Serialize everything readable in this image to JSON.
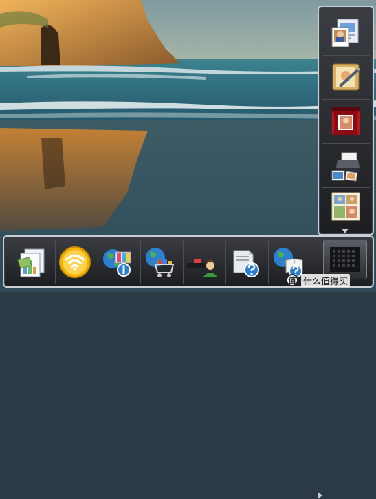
{
  "watermark": {
    "badge": "值",
    "text": "什么值得买"
  },
  "side_tray": {
    "items": [
      {
        "icon": "photo-album-icon"
      },
      {
        "icon": "photo-edit-icon"
      },
      {
        "icon": "slideshow-theater-icon"
      },
      {
        "icon": "photo-printer-icon"
      },
      {
        "icon": "collage-layout-icon"
      }
    ],
    "more_icon": "triangle-down-icon"
  },
  "bottom_dock": {
    "items": [
      {
        "icon": "documents-chart-icon"
      },
      {
        "icon": "wireless-connection-icon"
      },
      {
        "icon": "globe-info-icon"
      },
      {
        "icon": "globe-shopping-cart-icon"
      },
      {
        "icon": "printer-user-icon"
      },
      {
        "icon": "document-help-icon"
      },
      {
        "icon": "globe-manual-help-icon"
      }
    ],
    "more_icon": "triangle-right-icon",
    "launcher_icon": "app-grid-icon"
  },
  "colors": {
    "sky": "#8aa8a8",
    "sea": "#2f6d7b",
    "sand_reflection": "#b86e1f",
    "panel_border": "#c9ced4",
    "panel_bg": "#2a2d31",
    "wifi_yellow": "#f4b400"
  }
}
